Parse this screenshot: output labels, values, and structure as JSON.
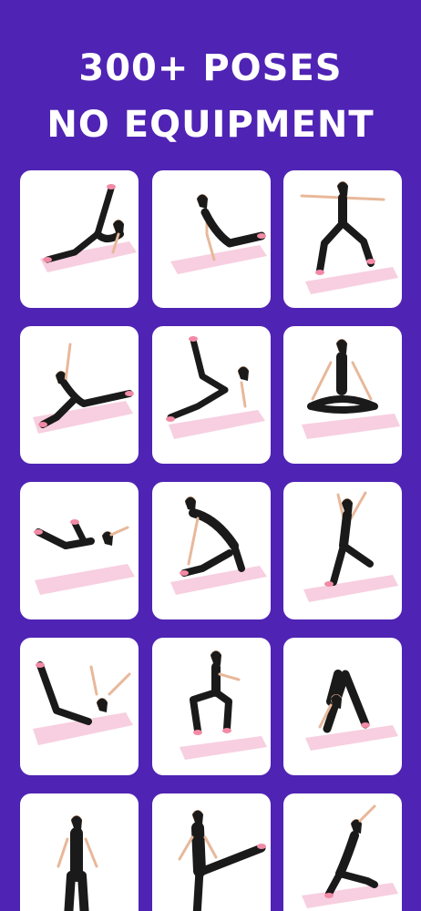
{
  "headline": {
    "line1": "300+ POSES",
    "line2": "NO EQUIPMENT"
  },
  "colors": {
    "background": "#4f23b4",
    "card": "#ffffff",
    "mat": "#f7cfe0",
    "outfit": "#1a1a1a",
    "skin": "#e8b89a",
    "shoe": "#f28aa6"
  },
  "poses": [
    {
      "icon": "split-leg-raise-pose-icon"
    },
    {
      "icon": "side-plank-pose-icon"
    },
    {
      "icon": "warrior-two-pose-icon"
    },
    {
      "icon": "lateral-lunge-stretch-pose-icon"
    },
    {
      "icon": "reverse-table-leg-raise-pose-icon"
    },
    {
      "icon": "seated-meditation-pose-icon"
    },
    {
      "icon": "bicycle-crunch-pose-icon"
    },
    {
      "icon": "twisted-lunge-pose-icon"
    },
    {
      "icon": "crescent-lunge-backbend-pose-icon"
    },
    {
      "icon": "v-up-crunch-pose-icon"
    },
    {
      "icon": "squat-pose-icon"
    },
    {
      "icon": "downward-dog-pose-icon"
    },
    {
      "icon": "standing-pose-icon"
    },
    {
      "icon": "high-kick-pose-icon"
    },
    {
      "icon": "low-lunge-reach-pose-icon"
    }
  ]
}
